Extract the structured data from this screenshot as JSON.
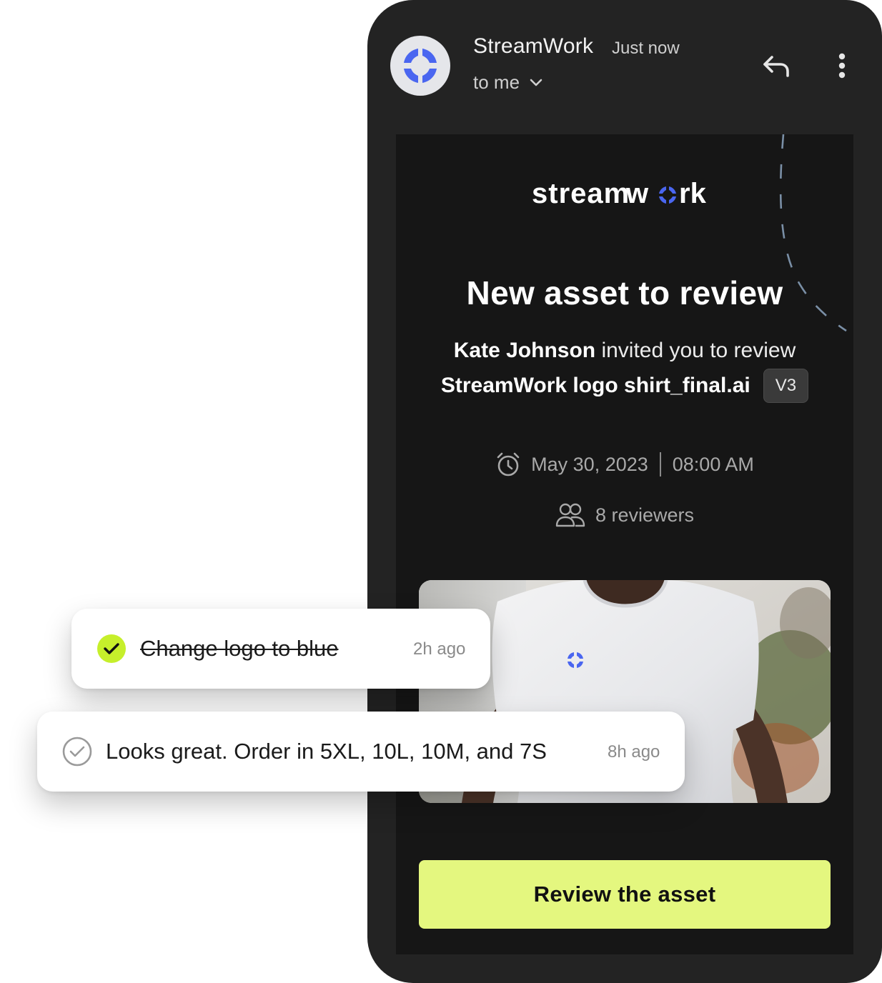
{
  "email_header": {
    "sender": "StreamWork",
    "time": "Just now",
    "recipient": "to me",
    "icons": [
      "streamwork-logo-icon",
      "chevron-down-icon",
      "reply-icon",
      "more-vertical-icon"
    ]
  },
  "email": {
    "brand_wordmark": "streamwork",
    "headline": "New asset to review",
    "inviter": "Kate Johnson",
    "invite_text": " invited you to review",
    "file_name": "StreamWork logo shirt_final.ai",
    "version": "V3",
    "date": "May 30, 2023",
    "time": "08:00 AM",
    "reviewers": "8 reviewers",
    "cta_label": "Review the asset"
  },
  "comments": [
    {
      "text": "Change logo to blue",
      "time": "2h ago",
      "resolved": true
    },
    {
      "text": "Looks great. Order in 5XL, 10L, 10M, and 7S",
      "time": "8h ago",
      "resolved": false
    }
  ],
  "colors": {
    "accent_lime": "#e4f77f",
    "brand_blue": "#4a66f0",
    "check_green": "#c6ef2b",
    "phone_bg": "#232323",
    "card_bg": "#161616"
  }
}
